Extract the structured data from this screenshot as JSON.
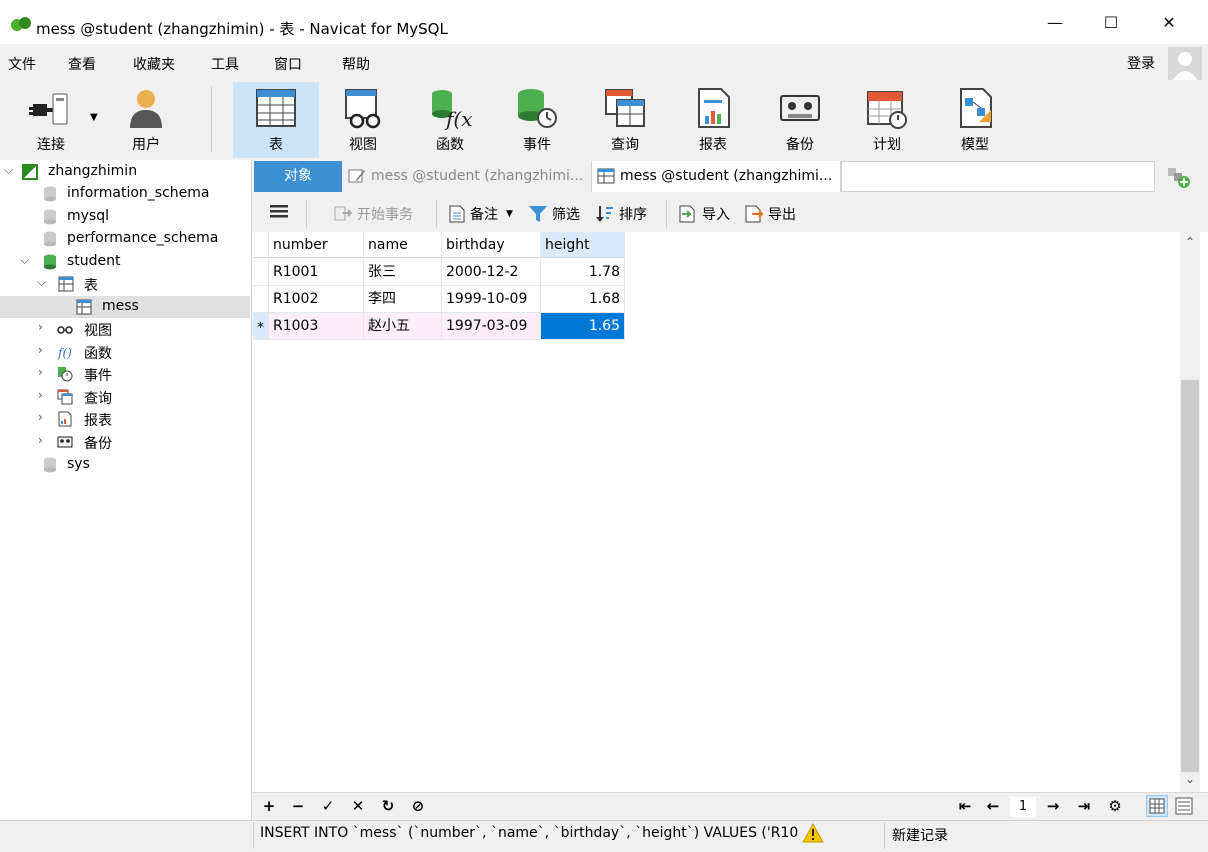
{
  "window": {
    "title": "mess @student (zhangzhimin) - 表 - Navicat for MySQL",
    "minimize": "—",
    "maximize": "☐",
    "close": "✕"
  },
  "menu": {
    "items": [
      "文件",
      "查看",
      "收藏夹",
      "工具",
      "窗口",
      "帮助"
    ],
    "login": "登录"
  },
  "toolbar": {
    "connect": "连接",
    "user": "用户",
    "table": "表",
    "view": "视图",
    "function": "函数",
    "event": "事件",
    "query": "查询",
    "report": "报表",
    "backup": "备份",
    "schedule": "计划",
    "model": "模型"
  },
  "tree": {
    "connection": "zhangzhimin",
    "databases": [
      "information_schema",
      "mysql",
      "performance_schema",
      "student",
      "sys"
    ],
    "student_children": {
      "tables": "表",
      "table_mess": "mess",
      "views": "视图",
      "functions": "函数",
      "events": "事件",
      "queries": "查询",
      "reports": "报表",
      "backups": "备份"
    }
  },
  "tabs": {
    "objects": "对象",
    "design": "mess @student (zhangzhimi...",
    "data": "mess @student (zhangzhimi..."
  },
  "gridtoolbar": {
    "begin_transaction": "开始事务",
    "memo": "备注",
    "filter": "筛选",
    "sort": "排序",
    "import": "导入",
    "export": "导出"
  },
  "grid": {
    "columns": [
      "number",
      "name",
      "birthday",
      "height"
    ],
    "rows": [
      [
        "R1001",
        "张三",
        "2000-12-2",
        "1.78"
      ],
      [
        "R1002",
        "李四",
        "1999-10-09",
        "1.68"
      ],
      [
        "R1003",
        "赵小五",
        "1997-03-09",
        "1.65"
      ]
    ],
    "current_row_marker": "*"
  },
  "navbar": {
    "page": "1"
  },
  "status": {
    "sql": "INSERT INTO `mess` (`number`, `name`, `birthday`, `height`) VALUES ('R10",
    "mode": "新建记录"
  },
  "colors": {
    "accent": "#3d8fd4",
    "selection": "#0078d7",
    "active_tab_bg": "#cce4f7",
    "new_row": "#fdeefa"
  }
}
